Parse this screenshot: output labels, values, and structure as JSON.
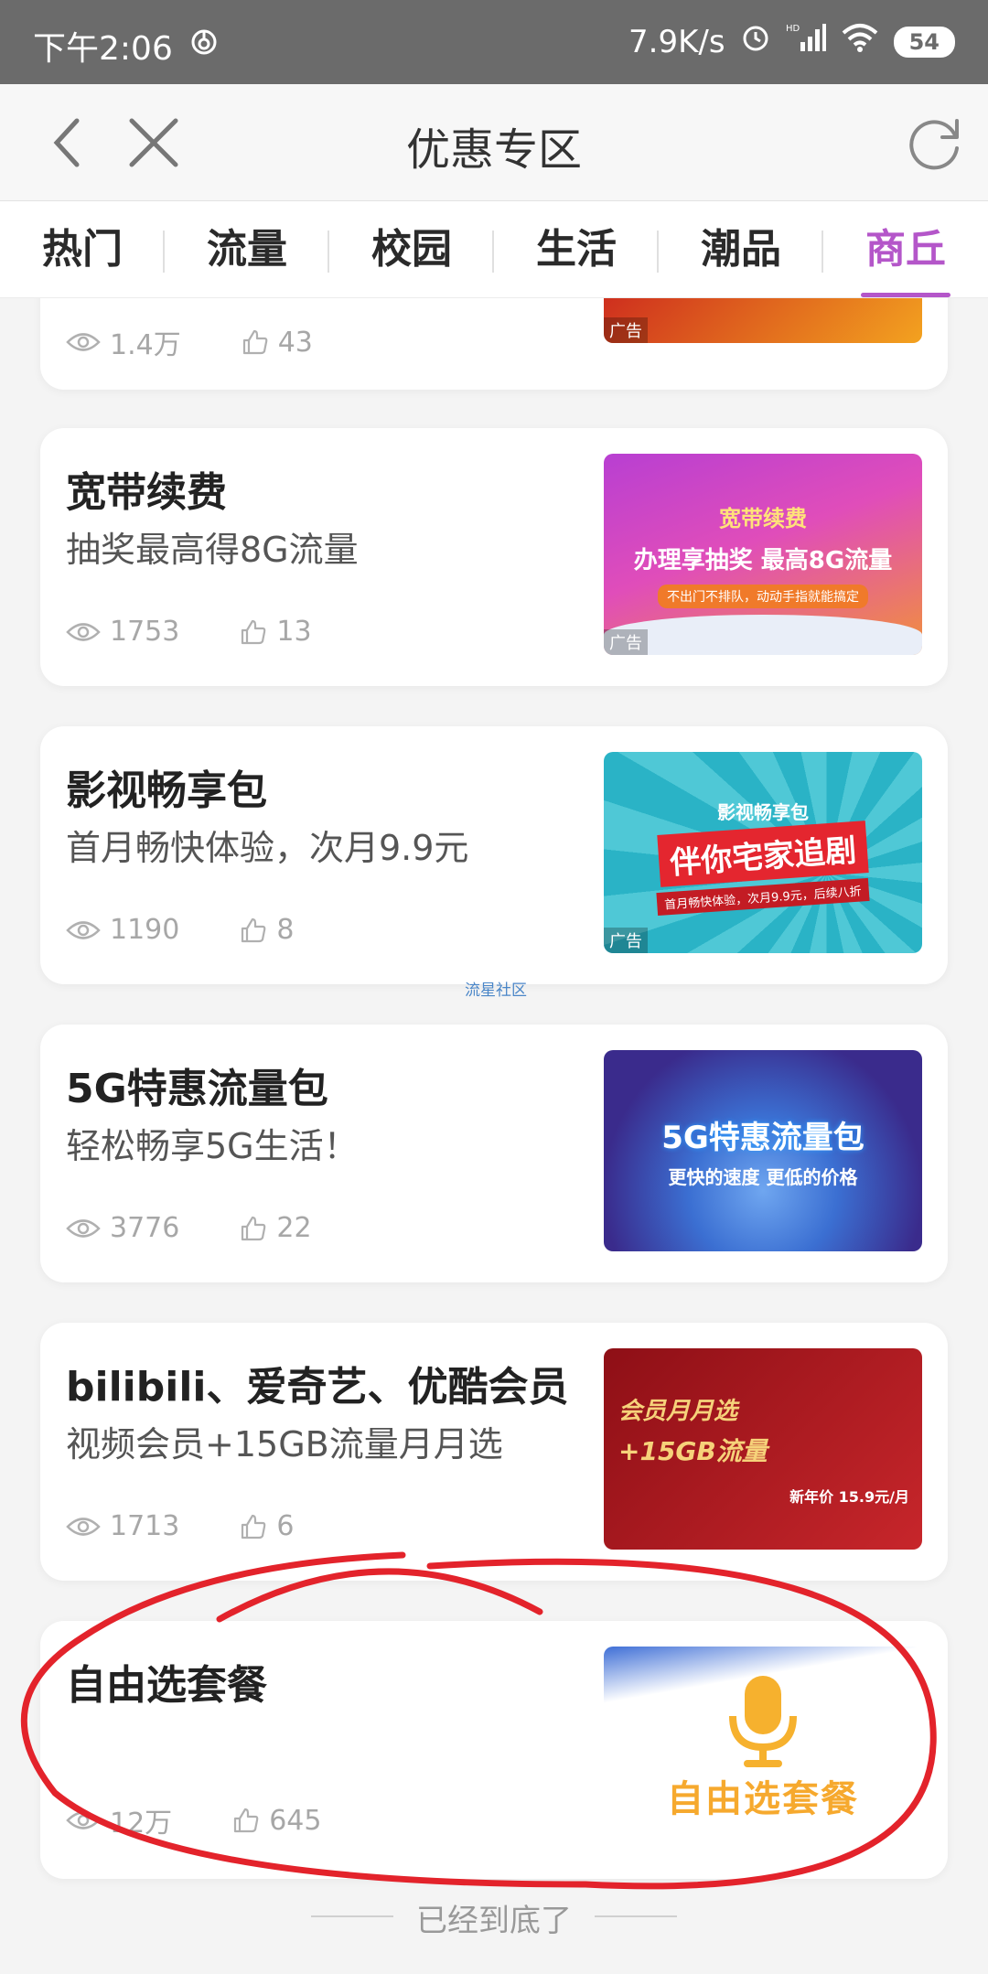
{
  "status_bar": {
    "time": "下午2:06",
    "speed": "7.9K/s",
    "battery": "54",
    "hd": "HD"
  },
  "header": {
    "title": "优惠专区"
  },
  "tabs": [
    {
      "label": "热门"
    },
    {
      "label": "流量"
    },
    {
      "label": "校园"
    },
    {
      "label": "生活"
    },
    {
      "label": "潮品"
    },
    {
      "label": "商丘"
    }
  ],
  "cards": [
    {
      "title": "",
      "subtitle": "",
      "views": "1.4万",
      "likes": "43",
      "image": {
        "ad": "广告",
        "colors": [
          "#d8202a",
          "#f5a623"
        ]
      }
    },
    {
      "title": "宽带续费",
      "subtitle": "抽奖最高得8G流量",
      "views": "1753",
      "likes": "13",
      "image": {
        "line1": "宽带续费",
        "line2": "办理享抽奖 最高8G流量",
        "line3": "不出门不排队，动动手指就能搞定",
        "ad": "广告",
        "colors": [
          "#c33fd0",
          "#f08a2e"
        ]
      }
    },
    {
      "title": "影视畅享包",
      "subtitle": "首月畅快体验，次月9.9元",
      "views": "1190",
      "likes": "8",
      "image": {
        "line1": "影视畅享包",
        "line2": "伴你宅家追剧",
        "line3": "首月畅快体验，次月9.9元，后续八折",
        "ad": "广告",
        "colors": [
          "#2fb7c9",
          "#e5262e"
        ]
      }
    },
    {
      "title": "5G特惠流量包",
      "subtitle": "轻松畅享5G生活！",
      "views": "3776",
      "likes": "22",
      "image": {
        "line1": "5G特惠流量包",
        "line2": "更快的速度 更低的价格",
        "line3": "",
        "ad": "",
        "colors": [
          "#3c2b8e",
          "#2f84d8"
        ]
      }
    },
    {
      "title": "bilibili、爱奇艺、优酷会员",
      "subtitle": "视频会员+15GB流量月月选",
      "views": "1713",
      "likes": "6",
      "image": {
        "line1": "会员月月选",
        "line2": "+15GB流量",
        "line3": "新年价 15.9元/月",
        "ad": "",
        "colors": [
          "#a3151c",
          "#d32d2d"
        ]
      }
    },
    {
      "title": "自由选套餐",
      "subtitle": "",
      "views": "12万",
      "likes": "645",
      "image": {
        "line1": "",
        "line2": "自由选套餐",
        "line3": "",
        "ad": "",
        "colors": [
          "#ffffff",
          "#f5b336"
        ]
      }
    }
  ],
  "footer": {
    "text": "已经到底了"
  },
  "watermark": "流星社区",
  "colors": {
    "accent": "#b456c9",
    "annotation_red": "#e3232b"
  }
}
